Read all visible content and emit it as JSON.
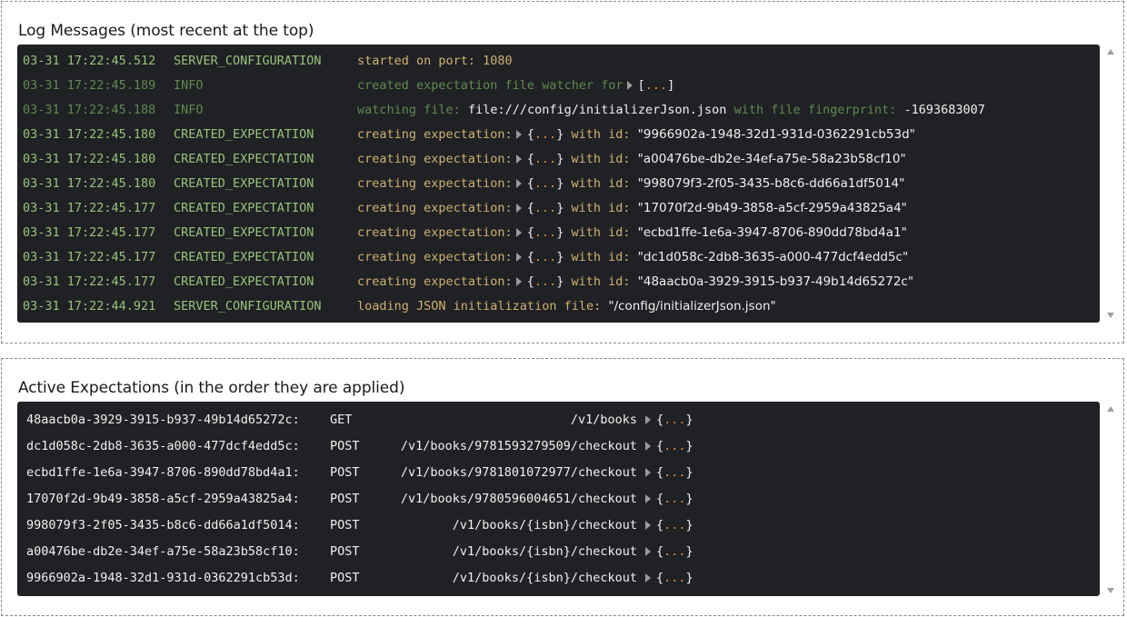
{
  "log_panel": {
    "title": "Log Messages (most recent at the top)",
    "rows": [
      {
        "time": "03-31 17:22:45.512",
        "level": "SERVER_CONFIGURATION",
        "kind": "text",
        "message": "started on port: 1080"
      },
      {
        "time": "03-31 17:22:45.189",
        "level": "INFO",
        "kind": "watcher",
        "message": "created expectation file watcher for",
        "open": "[",
        "dots": "...",
        "close": "]"
      },
      {
        "time": "03-31 17:22:45.188",
        "level": "INFO",
        "kind": "file",
        "message": "watching file:",
        "file": "file:///config/initializerJson.json",
        "middle": "with file fingerprint:",
        "value": "-1693683007"
      },
      {
        "time": "03-31 17:22:45.180",
        "level": "CREATED_EXPECTATION",
        "kind": "expectation",
        "message": "creating expectation:",
        "open": "{",
        "dots": "...",
        "close": "}",
        "with": "with id:",
        "id": "\"9966902a-1948-32d1-931d-0362291cb53d\""
      },
      {
        "time": "03-31 17:22:45.180",
        "level": "CREATED_EXPECTATION",
        "kind": "expectation",
        "message": "creating expectation:",
        "open": "{",
        "dots": "...",
        "close": "}",
        "with": "with id:",
        "id": "\"a00476be-db2e-34ef-a75e-58a23b58cf10\""
      },
      {
        "time": "03-31 17:22:45.180",
        "level": "CREATED_EXPECTATION",
        "kind": "expectation",
        "message": "creating expectation:",
        "open": "{",
        "dots": "...",
        "close": "}",
        "with": "with id:",
        "id": "\"998079f3-2f05-3435-b8c6-dd66a1df5014\""
      },
      {
        "time": "03-31 17:22:45.177",
        "level": "CREATED_EXPECTATION",
        "kind": "expectation",
        "message": "creating expectation:",
        "open": "{",
        "dots": "...",
        "close": "}",
        "with": "with id:",
        "id": "\"17070f2d-9b49-3858-a5cf-2959a43825a4\""
      },
      {
        "time": "03-31 17:22:45.177",
        "level": "CREATED_EXPECTATION",
        "kind": "expectation",
        "message": "creating expectation:",
        "open": "{",
        "dots": "...",
        "close": "}",
        "with": "with id:",
        "id": "\"ecbd1ffe-1e6a-3947-8706-890dd78bd4a1\""
      },
      {
        "time": "03-31 17:22:45.177",
        "level": "CREATED_EXPECTATION",
        "kind": "expectation",
        "message": "creating expectation:",
        "open": "{",
        "dots": "...",
        "close": "}",
        "with": "with id:",
        "id": "\"dc1d058c-2db8-3635-a000-477dcf4edd5c\""
      },
      {
        "time": "03-31 17:22:45.177",
        "level": "CREATED_EXPECTATION",
        "kind": "expectation",
        "message": "creating expectation:",
        "open": "{",
        "dots": "...",
        "close": "}",
        "with": "with id:",
        "id": "\"48aacb0a-3929-3915-b937-49b14d65272c\""
      },
      {
        "time": "03-31 17:22:44.921",
        "level": "SERVER_CONFIGURATION",
        "kind": "loading",
        "message": "loading JSON initialization file:",
        "value": "\"/config/initializerJson.json\""
      }
    ]
  },
  "expectations_panel": {
    "title": "Active Expectations (in the order they are applied)",
    "rows": [
      {
        "id": "48aacb0a-3929-3915-b937-49b14d65272c:",
        "method": "GET",
        "path": "/v1/books",
        "open": "{",
        "dots": "...",
        "close": "}"
      },
      {
        "id": "dc1d058c-2db8-3635-a000-477dcf4edd5c:",
        "method": "POST",
        "path": "/v1/books/9781593279509/checkout",
        "open": "{",
        "dots": "...",
        "close": "}"
      },
      {
        "id": "ecbd1ffe-1e6a-3947-8706-890dd78bd4a1:",
        "method": "POST",
        "path": "/v1/books/9781801072977/checkout",
        "open": "{",
        "dots": "...",
        "close": "}"
      },
      {
        "id": "17070f2d-9b49-3858-a5cf-2959a43825a4:",
        "method": "POST",
        "path": "/v1/books/9780596004651/checkout",
        "open": "{",
        "dots": "...",
        "close": "}"
      },
      {
        "id": "998079f3-2f05-3435-b8c6-dd66a1df5014:",
        "method": "POST",
        "path": "/v1/books/{isbn}/checkout",
        "open": "{",
        "dots": "...",
        "close": "}"
      },
      {
        "id": "a00476be-db2e-34ef-a75e-58a23b58cf10:",
        "method": "POST",
        "path": "/v1/books/{isbn}/checkout",
        "open": "{",
        "dots": "...",
        "close": "}"
      },
      {
        "id": "9966902a-1948-32d1-931d-0362291cb53d:",
        "method": "POST",
        "path": "/v1/books/{isbn}/checkout",
        "open": "{",
        "dots": "...",
        "close": "}"
      }
    ]
  },
  "colors": {
    "console_bg": "#1f2124",
    "timestamp": "#98c379",
    "info": "#5f8a50",
    "message": "#d0b070",
    "dots": "#e0903a"
  },
  "icons": {
    "expand": "caret-right-icon",
    "scroll_up": "scroll-up-arrow-icon",
    "scroll_down": "scroll-down-arrow-icon"
  }
}
